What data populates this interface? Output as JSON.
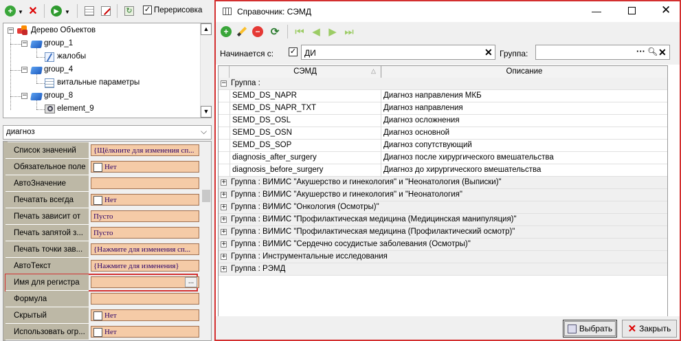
{
  "left_toolbar": {
    "redraw_label": "Перерисовка"
  },
  "tree": {
    "root": "Дерево Объектов",
    "items": [
      {
        "label": "group_1"
      },
      {
        "label": "жалобы"
      },
      {
        "label": "group_4"
      },
      {
        "label": "витальные параметры"
      },
      {
        "label": "group_8"
      },
      {
        "label": "element_9"
      }
    ]
  },
  "combo": {
    "value": "диагноз"
  },
  "properties": [
    {
      "label": "Список значений",
      "value": "{Щёлкните для изменения сп..."
    },
    {
      "label": "Обязательное поле",
      "value": "Нет",
      "checkbox": true
    },
    {
      "label": "АвтоЗначение",
      "value": ""
    },
    {
      "label": "Печатать всегда",
      "value": "Нет",
      "checkbox": true
    },
    {
      "label": "Печать зависит от",
      "value": "Пусто"
    },
    {
      "label": "Печать запятой з...",
      "value": "Пусто"
    },
    {
      "label": "Печать точки зав...",
      "value": "{Нажмите для изменения сп..."
    },
    {
      "label": "АвтоТекст",
      "value": "{Нажмите для изменения}"
    },
    {
      "label": "Имя для регистра",
      "value": "",
      "button": "..."
    },
    {
      "label": "Формула",
      "value": ""
    },
    {
      "label": "Скрытый",
      "value": "Нет",
      "checkbox": true
    },
    {
      "label": "Использовать огр...",
      "value": "Нет",
      "checkbox": true
    }
  ],
  "dialog": {
    "title": "Справочник: СЭМД",
    "filter_label": "Начинается с:",
    "filter_value": "ДИ",
    "group_label": "Группа:",
    "group_value": "",
    "columns": [
      "СЭМД",
      "Описание"
    ],
    "expanded_group": "Группа :",
    "rows": [
      {
        "code": "SEMD_DS_NAPR",
        "desc": "Диагноз направления МКБ"
      },
      {
        "code": "SEMD_DS_NAPR_TXT",
        "desc": "Диагноз направления"
      },
      {
        "code": "SEMD_DS_OSL",
        "desc": "Диагноз осложнения"
      },
      {
        "code": "SEMD_DS_OSN",
        "desc": "Диагноз основной"
      },
      {
        "code": "SEMD_DS_SOP",
        "desc": "Диагноз сопутствующий"
      },
      {
        "code": "diagnosis_after_surgery",
        "desc": "Диагноз после хирургического вмешательства"
      },
      {
        "code": "diagnosis_before_surgery",
        "desc": "Диагноз до хирургического вмешательства"
      }
    ],
    "groups": [
      "Группа : ВИМИС \"Акушерство и гинекология\" и \"Неонатология (Выписки)\"",
      "Группа : ВИМИС \"Акушерство и гинекология\" и \"Неонатология\"",
      "Группа : ВИМИС \"Онкология (Осмотры)\"",
      "Группа : ВИМИС \"Профилактическая медицина (Медицинская манипуляция)\"",
      "Группа : ВИМИС \"Профилактическая медицина (Профилактический осмотр)\"",
      "Группа : ВИМИС \"Сердечно сосудистые заболевания (Осмотры)\"",
      "Группа : Инструментальные исследования",
      "Группа : РЭМД"
    ],
    "select_button": "Выбрать",
    "close_button": "Закрыть"
  },
  "colors": {
    "accent_border": "#d32f2f",
    "property_value_bg": "#f5cba7",
    "property_label_bg": "#bdb8a6"
  }
}
